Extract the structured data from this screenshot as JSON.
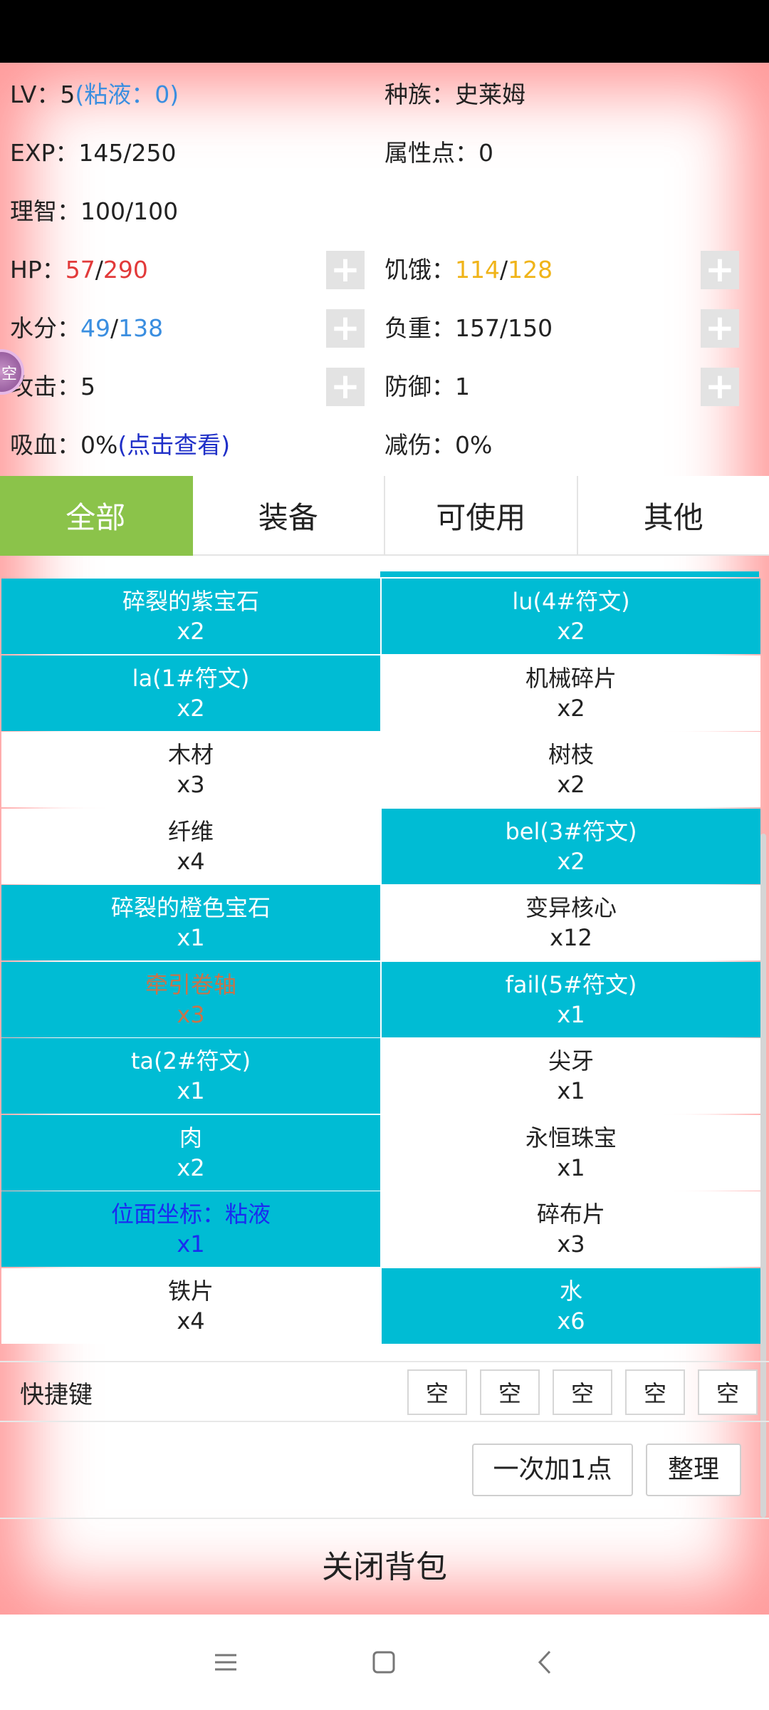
{
  "stats": {
    "lv_label": "LV：",
    "lv_value": "5",
    "slime_text": "(粘液：0)",
    "race": "种族：史莱姆",
    "exp": "EXP：145/250",
    "attr_points": "属性点：0",
    "sanity": "理智：100/100",
    "hp_label": "HP：",
    "hp_current": "57",
    "hp_sep": "/",
    "hp_max": "290",
    "hunger_label": "饥饿：",
    "hunger_current": "114",
    "hunger_sep": "/",
    "hunger_max": "128",
    "water_label": "水分：",
    "water_current": "49",
    "water_sep": "/",
    "water_max": "138",
    "weight": "负重：157/150",
    "attack": "攻击：5",
    "defense": "防御：1",
    "lifesteal_label": "吸血：0%",
    "lifesteal_link": "(点击查看)",
    "dmg_reduction": "减伤：0%"
  },
  "plus_symbol": "+",
  "orb_text": "空",
  "tabs": [
    {
      "label": "全部",
      "active": true
    },
    {
      "label": "装备",
      "active": false
    },
    {
      "label": "可使用",
      "active": false
    },
    {
      "label": "其他",
      "active": false
    }
  ],
  "items": [
    {
      "name": "碎裂的紫宝石",
      "count": "x2"
    },
    {
      "name": "lu(4#符文)",
      "count": "x2"
    },
    {
      "name": "la(1#符文)",
      "count": "x2"
    },
    {
      "name": "机械碎片",
      "count": "x2"
    },
    {
      "name": "木材",
      "count": "x3"
    },
    {
      "name": "树枝",
      "count": "x2"
    },
    {
      "name": "纤维",
      "count": "x4"
    },
    {
      "name": "bel(3#符文)",
      "count": "x2"
    },
    {
      "name": "碎裂的橙色宝石",
      "count": "x1"
    },
    {
      "name": "变异核心",
      "count": "x12"
    },
    {
      "name": "牵引卷轴",
      "count": "x3"
    },
    {
      "name": "fail(5#符文)",
      "count": "x1"
    },
    {
      "name": "ta(2#符文)",
      "count": "x1"
    },
    {
      "name": "尖牙",
      "count": "x1"
    },
    {
      "name": "肉",
      "count": "x2"
    },
    {
      "name": "永恒珠宝",
      "count": "x1"
    },
    {
      "name": "位面坐标：粘液",
      "count": "x1"
    },
    {
      "name": "碎布片",
      "count": "x3"
    },
    {
      "name": "铁片",
      "count": "x4"
    },
    {
      "name": "水",
      "count": "x6"
    }
  ],
  "quickbar": {
    "label": "快捷键",
    "slots": [
      "空",
      "空",
      "空",
      "空",
      "空"
    ]
  },
  "buttons": {
    "add_one": "一次加1点",
    "sort": "整理",
    "close_bag": "关闭背包"
  },
  "colors": {
    "teal": "#00bcd4",
    "active_tab": "#8bc34a",
    "hp_red": "#e23a3a",
    "hunger_gold": "#f0b419",
    "water_blue": "#3a8ee0"
  }
}
